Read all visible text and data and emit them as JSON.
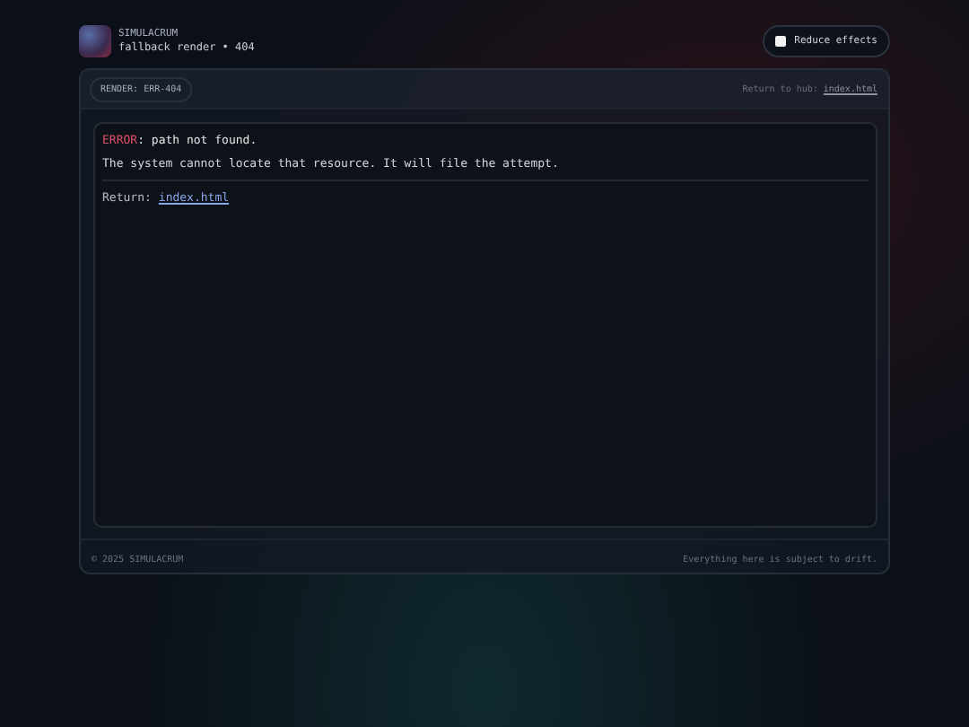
{
  "brand": {
    "name": "SIMULACRUM",
    "subtitle": "fallback render • 404"
  },
  "reduce_effects": {
    "label": "Reduce effects",
    "checked": false
  },
  "card": {
    "badge": "RENDER: ERR-404",
    "hub_label": "Return to hub:",
    "hub_link": "index.html"
  },
  "error": {
    "label": "ERROR",
    "message": ": path not found.",
    "detail": "The system cannot locate that resource. It will file the attempt.",
    "return_label": "Return:",
    "return_link": "index.html"
  },
  "footer": {
    "copyright": "© 2025 SIMULACRUM",
    "note": "Everything here is subject to drift."
  }
}
